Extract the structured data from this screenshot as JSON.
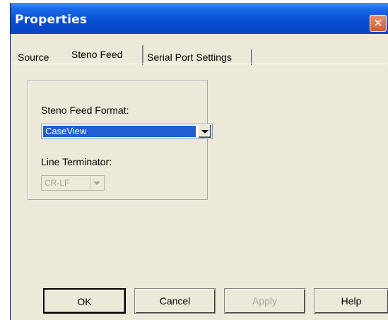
{
  "window": {
    "title": "Properties",
    "close_glyph": "✕"
  },
  "tabs": [
    {
      "label": "Source",
      "active": false
    },
    {
      "label": "Steno Feed",
      "active": true
    },
    {
      "label": "Serial Port Settings",
      "active": false
    }
  ],
  "steno_feed": {
    "format_label": "Steno Feed Format:",
    "format_value": "CaseView",
    "terminator_label": "Line Terminator:",
    "terminator_value": "CR-LF",
    "terminator_enabled": false
  },
  "buttons": {
    "ok": "OK",
    "cancel": "Cancel",
    "apply": "Apply",
    "help": "Help"
  },
  "colors": {
    "title_bar": "#0A4FD6",
    "selection": "#1F5FD2",
    "close_button": "#D65A33",
    "face": "#ECE9D8"
  }
}
